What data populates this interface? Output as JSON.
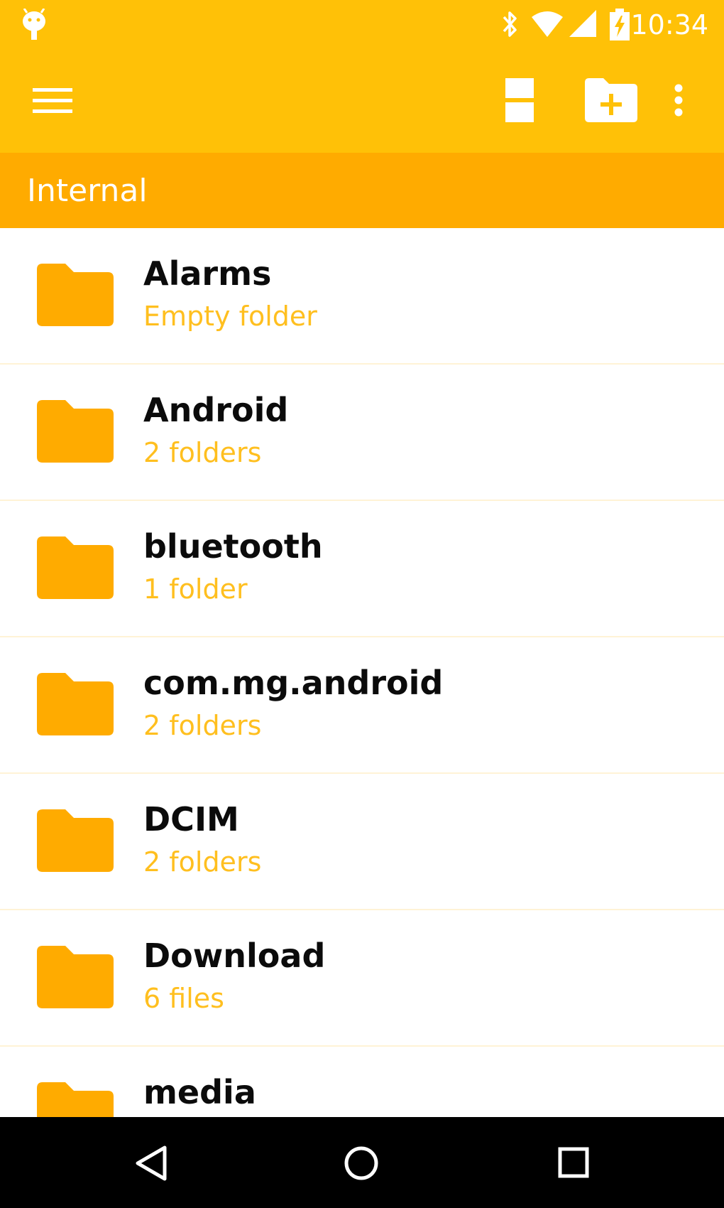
{
  "status_bar": {
    "time": "10:34",
    "icons": [
      "android-debug-icon",
      "bluetooth-icon",
      "wifi-icon",
      "cell-signal-icon",
      "battery-charging-icon"
    ]
  },
  "app_bar": {
    "menu_icon": "hamburger-menu-icon",
    "actions": [
      "view-toggle-icon",
      "new-folder-icon",
      "overflow-menu-icon"
    ]
  },
  "location": {
    "label": "Internal"
  },
  "folders": [
    {
      "name": "Alarms",
      "meta": "Empty folder"
    },
    {
      "name": "Android",
      "meta": "2 folders"
    },
    {
      "name": "bluetooth",
      "meta": "1 folder"
    },
    {
      "name": "com.mg.android",
      "meta": "2 folders"
    },
    {
      "name": "DCIM",
      "meta": "2 folders"
    },
    {
      "name": "Download",
      "meta": "6 files"
    },
    {
      "name": "media",
      "meta": ""
    }
  ],
  "nav_bar": {
    "buttons": [
      "back-icon",
      "home-icon",
      "recents-icon"
    ]
  },
  "colors": {
    "app_bar": "#ffc107",
    "location_bar": "#ffab00",
    "folder_icon": "#ffab00",
    "meta_text": "#ffbf1f",
    "nav_bar": "#000000"
  }
}
